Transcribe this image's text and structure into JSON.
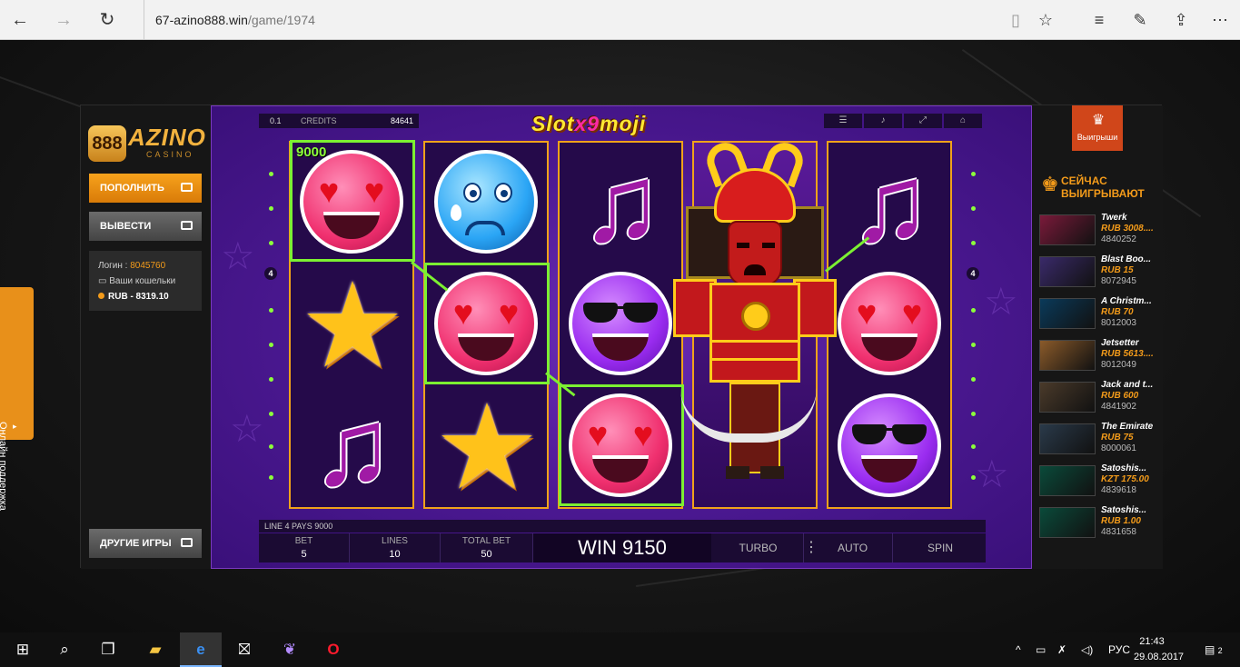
{
  "browser": {
    "url_host": "67-azino888.win",
    "url_path": "/game/1974"
  },
  "sidebar": {
    "logo_text": "AZINO",
    "logo_mark": "888",
    "logo_sub": "CASINO",
    "deposit_label": "ПОПОЛНИТЬ",
    "withdraw_label": "ВЫВЕСТИ",
    "login_label": "Логин :",
    "login_value": "8045760",
    "wallets_label": "Ваши кошельки",
    "balance": "RUB - 8319.10",
    "other_games_label": "ДРУГИЕ ИГРЫ"
  },
  "game": {
    "bet_value": "0.1",
    "credits_label": "CREDITS",
    "credits_value": "84641",
    "title_prefix": "Slot",
    "title_x9": "x9",
    "title_suffix": "moji",
    "win_amount_label": "9000",
    "line_number_left": "4",
    "line_number_right": "4",
    "info_strip": "LINE 4 PAYS 9000",
    "bet_label": "BET",
    "bet": "5",
    "lines_label": "LINES",
    "lines": "10",
    "total_bet_label": "TOTAL BET",
    "total_bet": "50",
    "win_text": "WIN 9150",
    "turbo_label": "TURBO",
    "auto_label": "AUTO",
    "spin_label": "SPIN",
    "reels": [
      [
        "pink-heart-eyes",
        "star",
        "music-note"
      ],
      [
        "blue-crying",
        "pink-heart-eyes",
        "star"
      ],
      [
        "music-note",
        "purple-sunglasses",
        "pink-heart-eyes"
      ],
      [
        "samurai-wild",
        "samurai-wild",
        "samurai-wild"
      ],
      [
        "music-note",
        "pink-heart-eyes",
        "purple-sunglasses"
      ]
    ]
  },
  "winners": {
    "tab_label": "Выигрыши",
    "heading_line1": "СЕЙЧАС",
    "heading_line2": "ВЫИГРЫВАЮТ",
    "items": [
      {
        "game": "Twerk",
        "amount": "RUB 3008....",
        "user": "4840252",
        "thumb": "#7a1a3a"
      },
      {
        "game": "Blast Boo...",
        "amount": "RUB 15",
        "user": "8072945",
        "thumb": "#3a2a6a"
      },
      {
        "game": "A Christm...",
        "amount": "RUB 70",
        "user": "8012003",
        "thumb": "#0a3a5a"
      },
      {
        "game": "Jetsetter",
        "amount": "RUB 5613....",
        "user": "8012049",
        "thumb": "#8a5a2a"
      },
      {
        "game": "Jack and t...",
        "amount": "RUB 600",
        "user": "4841902",
        "thumb": "#4a3a2a"
      },
      {
        "game": "The Emirate",
        "amount": "RUB 75",
        "user": "8000061",
        "thumb": "#2a3a4a"
      },
      {
        "game": "Satoshis...",
        "amount": "KZT 175.00",
        "user": "4839618",
        "thumb": "#0a4a3a"
      },
      {
        "game": "Satoshis...",
        "amount": "RUB 1.00",
        "user": "4831658",
        "thumb": "#0a4a3a"
      }
    ]
  },
  "support": {
    "label": "Онлайн поддержка"
  },
  "taskbar": {
    "lang": "РУС",
    "time": "21:43",
    "date": "29.08.2017",
    "notifications": "2"
  }
}
